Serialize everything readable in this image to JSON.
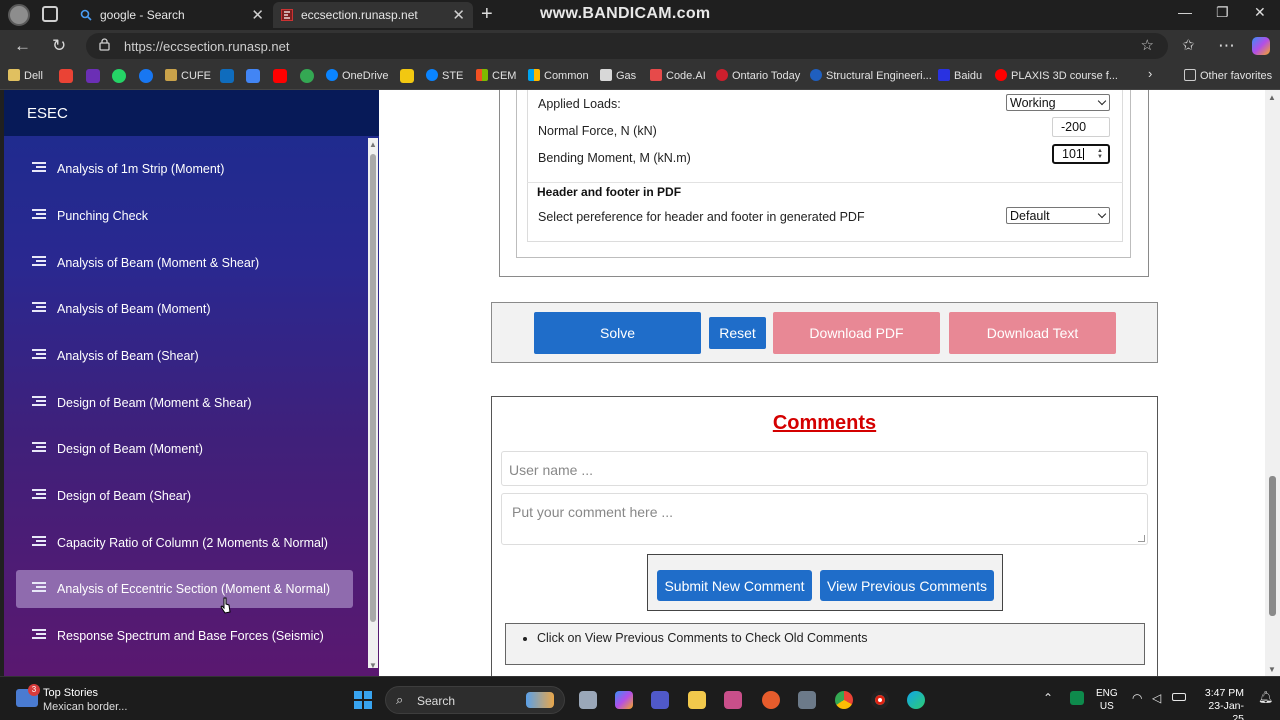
{
  "browser": {
    "tabs": [
      {
        "title": "google - Search"
      },
      {
        "title": "eccsection.runasp.net"
      }
    ],
    "watermark": "www.BANDICAM.com",
    "url": "https://eccsection.runasp.net",
    "bookmarks": [
      "Dell",
      "CUFE",
      "OneDrive",
      "STE",
      "CEM",
      "Common",
      "Gas",
      "Code.AI",
      "Ontario Today",
      "Structural Engineeri...",
      "Baidu",
      "PLAXIS 3D course f..."
    ],
    "other_favorites": "Other favorites"
  },
  "sidebar": {
    "title": "ESEC",
    "items": [
      {
        "label": "Analysis of 1m Strip (Moment)"
      },
      {
        "label": "Punching Check"
      },
      {
        "label": "Analysis of Beam (Moment & Shear)"
      },
      {
        "label": "Analysis of Beam (Moment)"
      },
      {
        "label": "Analysis of Beam (Shear)"
      },
      {
        "label": "Design of Beam (Moment & Shear)"
      },
      {
        "label": "Design of Beam (Moment)"
      },
      {
        "label": "Design of Beam (Shear)"
      },
      {
        "label": "Capacity Ratio of Column (2 Moments & Normal)"
      },
      {
        "label": "Analysis of Eccentric Section (Moment & Normal)"
      },
      {
        "label": "Response Spectrum and Base Forces (Seismic)"
      }
    ],
    "active_index": 9
  },
  "loads": {
    "applied_label": "Applied Loads:",
    "applied_value": "Working",
    "normal_label": "Normal Force, N (kN)",
    "normal_value": "-200",
    "moment_label": "Bending Moment, M (kN.m)",
    "moment_value": "101"
  },
  "pdf": {
    "legend": "Header and footer in PDF",
    "pref_label": "Select pereference for header and footer in generated PDF",
    "pref_value": "Default"
  },
  "actions": {
    "solve": "Solve",
    "reset": "Reset",
    "download_pdf": "Download PDF",
    "download_text": "Download Text"
  },
  "comments": {
    "title": "Comments",
    "user_placeholder": "User name ...",
    "comment_placeholder": "Put your comment here ...",
    "submit": "Submit New Comment",
    "view": "View Previous Comments",
    "note": "Click on View Previous Comments to Check Old Comments"
  },
  "taskbar": {
    "news_title": "Top Stories",
    "news_sub": "Mexican border...",
    "news_badge": "3",
    "search": "Search",
    "lang1": "ENG",
    "lang2": "US",
    "time": "3:47 PM",
    "date": "23-Jan-25"
  },
  "colors": {
    "primary_button": "#1f6dc9",
    "disabled_button": "#e88895",
    "comments_title": "#d40000",
    "sidebar_active": "#8f6bae"
  }
}
